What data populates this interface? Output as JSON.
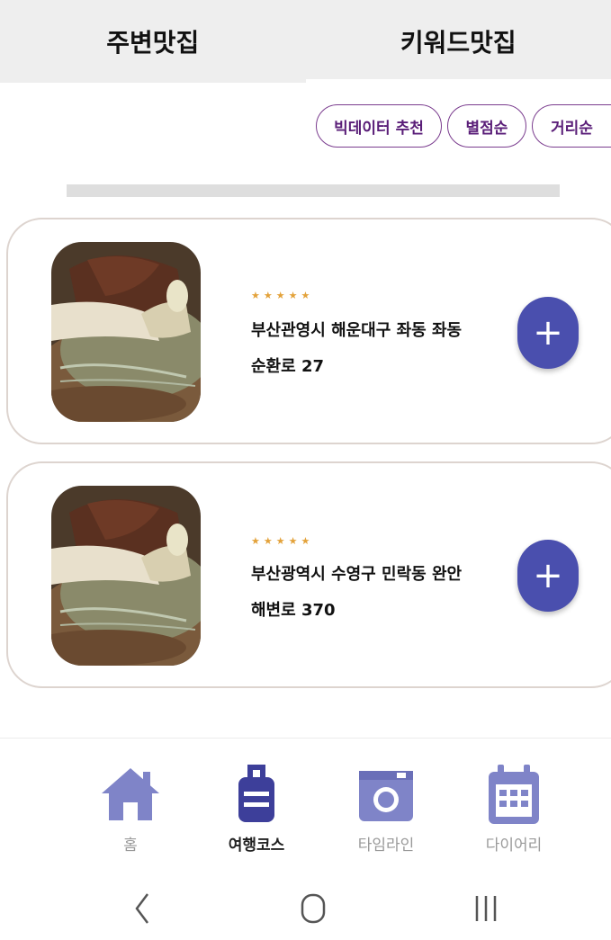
{
  "tabs": {
    "nearby": "주변맛집",
    "keyword": "키워드맛집"
  },
  "filters": [
    "빅데이터 추천",
    "별점순",
    "거리순"
  ],
  "restaurants": [
    {
      "stars": "★★★★★",
      "address": "부산관영시 해운대구 좌동 좌동순환로 27"
    },
    {
      "stars": "★★★★★",
      "address": "부산광역시 수영구 민락동 완안해변로 370"
    }
  ],
  "add_button_symbol": "+",
  "bottom_nav": [
    {
      "label": "홈",
      "icon": "home-icon",
      "active": false
    },
    {
      "label": "여행코스",
      "icon": "luggage-icon",
      "active": true
    },
    {
      "label": "타임라인",
      "icon": "camera-icon",
      "active": false
    },
    {
      "label": "다이어리",
      "icon": "calendar-icon",
      "active": false
    }
  ],
  "colors": {
    "accent": "#4a4fae",
    "chip_border": "#7a3c8e",
    "chip_text": "#5a1e78",
    "nav_icon": "#7f84c8",
    "nav_icon_active": "#3d3f9a",
    "stars": "#e3a23a"
  },
  "system_nav": [
    "back-icon",
    "home-icon",
    "recents-icon"
  ]
}
